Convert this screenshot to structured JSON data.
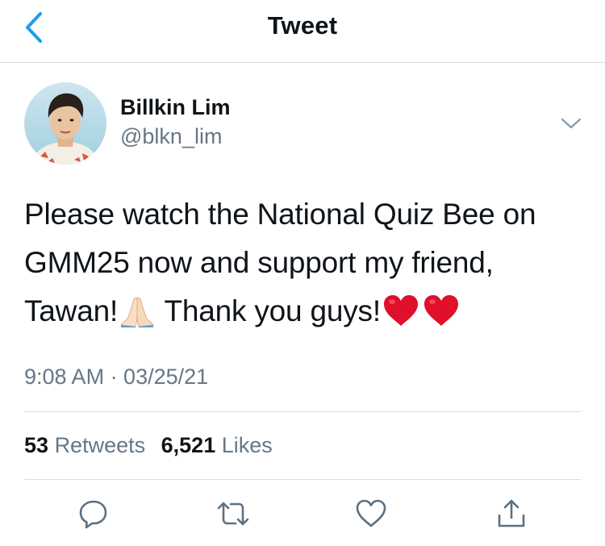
{
  "header": {
    "title": "Tweet",
    "back_icon": "chevron-left-icon"
  },
  "author": {
    "display_name": "Billkin Lim",
    "handle": "@blkn_lim"
  },
  "tweet": {
    "lines": [
      "Please watch the National Quiz Bee on",
      "GMM25 now and support my friend,"
    ],
    "line3_part1": "Tawan!",
    "line3_part2": " Thank you guys!",
    "emojis": [
      "folded-hands",
      "red-heart",
      "red-heart"
    ],
    "timestamp": "9:08 AM · 03/25/21"
  },
  "stats": {
    "retweets_count": "53",
    "retweets_label": "Retweets",
    "likes_count": "6,521",
    "likes_label": "Likes"
  },
  "actions": [
    "reply-icon",
    "retweet-icon",
    "like-icon",
    "share-icon"
  ],
  "colors": {
    "accent": "#1d9bf0",
    "secondary_text": "#667786",
    "divider": "#dcdde0",
    "heart": "#e0102a"
  }
}
